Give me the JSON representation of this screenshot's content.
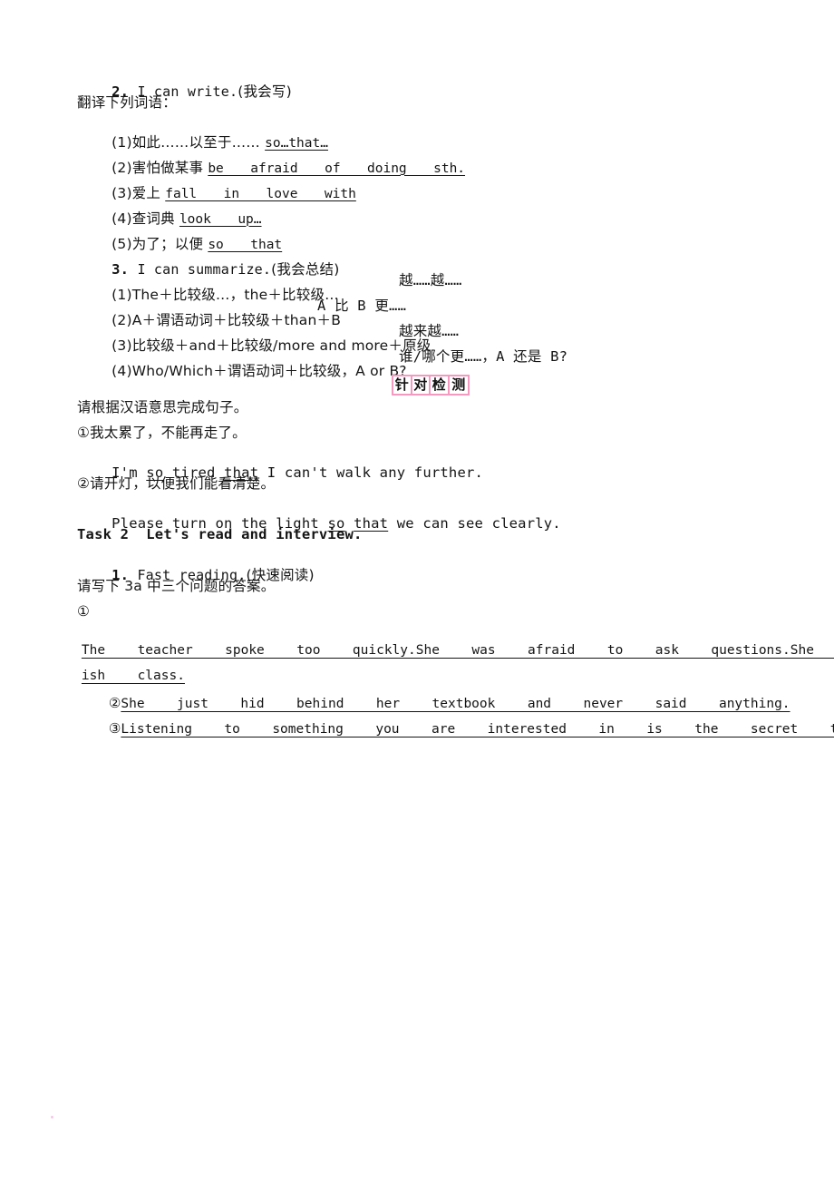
{
  "page": {
    "background": "#ffffff",
    "accent_pink": "#f49ac1",
    "text_color": "#141414"
  },
  "sections": {
    "can_write": {
      "number": "2.",
      "heading_en": " I can write.",
      "heading_cn": "(我会写)",
      "instruction": "翻译下列词语：",
      "items": [
        {
          "label": "(1)如此……以至于…… ",
          "answer": "so…that…"
        },
        {
          "label": "(2)害怕做某事 ",
          "answer": "be  afraid  of  doing  sth."
        },
        {
          "label": "(3)爱上 ",
          "answer": "fall  in  love  with"
        },
        {
          "label": "(4)查词典 ",
          "answer": "look  up…"
        },
        {
          "label": "(5)为了；以便 ",
          "answer": "so  that"
        }
      ]
    },
    "can_summarize": {
      "number": "3.",
      "heading_en": " I can summarize.",
      "heading_cn": "(我会总结)",
      "rules": [
        {
          "formula": "(1)The＋比较级…，the＋比较级…",
          "meaning": "越……越……"
        },
        {
          "formula": "(2)A＋谓语动词＋比较级＋than＋B",
          "meaning": "A 比 B 更……"
        },
        {
          "formula": "(3)比较级＋and＋比较级/more and more＋原级",
          "meaning": "越来越……"
        },
        {
          "formula": "(4)Who/Which＋谓语动词＋比较级，A or B?",
          "meaning": "谁/哪个更……，A 还是 B?"
        }
      ]
    },
    "badge": {
      "chars": [
        "针",
        "对",
        "检",
        "测"
      ],
      "border_color": "#f49ac1"
    },
    "practice": {
      "instruction": "请根据汉语意思完成句子。",
      "items": [
        {
          "marker_cn": "①我太累了，不能再走了。",
          "sentence_parts": [
            {
              "text": "I'm ",
              "underline": false
            },
            {
              "text": "so",
              "underline": true
            },
            {
              "text": " tired ",
              "underline": false
            },
            {
              "text": "that",
              "underline": true
            },
            {
              "text": " I can't walk any further.",
              "underline": false
            }
          ]
        },
        {
          "marker_cn": "②请开灯，以便我们能看清楚。",
          "sentence_parts": [
            {
              "text": "Please turn on the light ",
              "underline": false
            },
            {
              "text": "so",
              "underline": true
            },
            {
              "text": " ",
              "underline": false
            },
            {
              "text": "that",
              "underline": true
            },
            {
              "text": " we can see clearly.",
              "underline": false
            }
          ]
        }
      ]
    },
    "task2": {
      "title": "Task 2  Let's read and interview.",
      "sub_number": "1.",
      "sub_en": " Fast reading.",
      "sub_cn": "(快速阅读)",
      "instruction": "请写下 3a 中三个问题的答案。",
      "q1_marker": "①",
      "answers": [
        {
          "marker": "",
          "line1": "The  teacher  spoke  too  quickly.She  was  afraid  to  ask  questions.She  didn't  like  her  Engl",
          "line2": "ish  class."
        },
        {
          "marker": "②",
          "line1": "She  just  hid  behind  her  textbook  and  never  said  anything.",
          "line2": ""
        },
        {
          "marker": "③",
          "line1": "Listening  to  something  you  are  interested  in  is  the  secret  to  language  learning.",
          "line2": ""
        }
      ]
    }
  }
}
